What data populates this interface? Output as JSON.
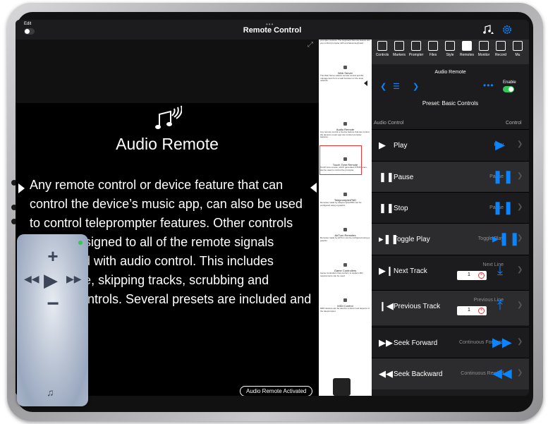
{
  "app": {
    "title": "Remote Control",
    "edit_label": "Edit"
  },
  "prompter": {
    "heading": "Audio Remote",
    "body": "Any remote control or device feature that can control the device’s music app, can also be used to control teleprompter features. Other controls can be assigned to all of the remote signals associated with audio control. This includes play/pause, skipping tracks, scrubbing and volume controls. Several presets are included and new ones",
    "status": "Audio Remote Activated"
  },
  "preview": {
    "titles": [
      "Web Server",
      "Audio Remote",
      "Touch Tone Remote",
      "TeleprompterPAD",
      "AirTurn Remotes",
      "Game Controllers",
      "MIDI Control"
    ]
  },
  "tabs": [
    {
      "label": "Controls",
      "icon": "controls-icon"
    },
    {
      "label": "Markers",
      "icon": "marker-icon"
    },
    {
      "label": "Prompter",
      "icon": "prompter-icon"
    },
    {
      "label": "Files",
      "icon": "files-icon"
    },
    {
      "label": "Style",
      "icon": "style-icon"
    },
    {
      "label": "Remotes",
      "icon": "remotes-icon"
    },
    {
      "label": "Monitor",
      "icon": "monitor-icon"
    },
    {
      "label": "Record",
      "icon": "record-icon"
    },
    {
      "label": "Mu",
      "icon": "music-icon"
    }
  ],
  "panel": {
    "section_title": "Audio Remote",
    "enable_label": "Enable",
    "preset": "Preset: Basic Controls",
    "col_left": "Audio Control",
    "col_right": "Control"
  },
  "rows": [
    {
      "label": "Play",
      "value": "Play",
      "icon": "play-icon",
      "glyph": "▶",
      "visual": "▶"
    },
    {
      "label": "Pause",
      "value": "Pause",
      "icon": "pause-icon",
      "glyph": "❚❚",
      "visual": "❚❚"
    },
    {
      "label": "Stop",
      "value": "Pause",
      "icon": "stop-icon",
      "glyph": "❚❚",
      "visual": "❚❚"
    },
    {
      "label": "Toggle Play",
      "value": "Toggle Play",
      "icon": "toggle-play-icon",
      "glyph": "▸❚❚",
      "visual": "▸❚❚"
    },
    {
      "label": "Next Track",
      "value": "Next Line",
      "icon": "next-track-icon",
      "glyph": "▶❙",
      "visual": "⤓",
      "stepper": "1"
    },
    {
      "label": "Previous Track",
      "value": "Previous Line",
      "icon": "previous-track-icon",
      "glyph": "❙◀",
      "visual": "⤒",
      "stepper": "1"
    },
    {
      "label": "Seek Forward",
      "value": "Continuous Forward",
      "icon": "seek-forward-icon",
      "glyph": "▶▶",
      "visual": "▶▶"
    },
    {
      "label": "Seek Backward",
      "value": "Continuous Rewind",
      "icon": "seek-backward-icon",
      "glyph": "◀◀",
      "visual": "◀◀"
    }
  ],
  "colors": {
    "accent": "#0a84ff",
    "enable": "#34c759",
    "highlight": "#e33333"
  }
}
